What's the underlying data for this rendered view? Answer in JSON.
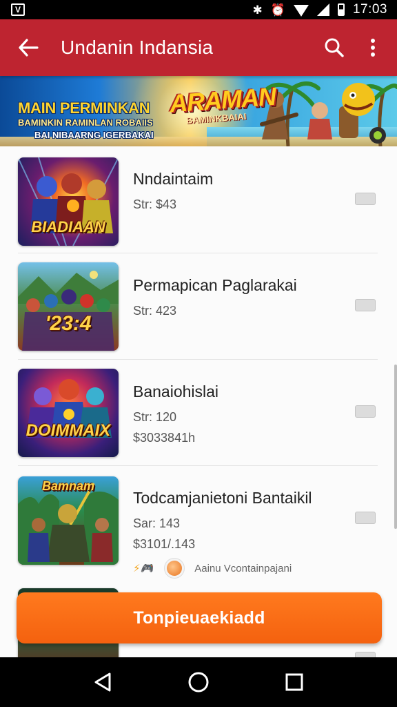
{
  "status_bar": {
    "time": "17:03",
    "icons": [
      "app-logo-icon",
      "nfc-icon",
      "alarm-icon",
      "wifi-icon",
      "signal-icon",
      "battery-icon"
    ]
  },
  "app_bar": {
    "title": "Undanin Indansia",
    "background": "#be2430",
    "icons": [
      "back-arrow-icon",
      "search-icon",
      "more-vert-icon"
    ]
  },
  "banner": {
    "headline": "MAIN PERMINKAN",
    "line2": "BAMINKIN RAMINLAN ROBAIIS",
    "line3": "BAI NIBAARNG IGERBAKAI",
    "logo": "ARAMAN",
    "logo_sub": "BAMINKBAIAI"
  },
  "items": [
    {
      "thumb_text": "BIADIAAN",
      "title": "Nndaintaim",
      "lines": [
        "Str: $43"
      ]
    },
    {
      "thumb_text": "'23:4",
      "title": "Permapican Paglarakai",
      "lines": [
        "Str: 423"
      ]
    },
    {
      "thumb_text": "DOIMMAIX",
      "title": "Banaiohislai",
      "lines": [
        "Str: 120",
        "$3033841h"
      ]
    },
    {
      "thumb_text": "Bamnam",
      "title": "Todcamjanietoni Bantaikil",
      "lines": [
        "Sar: 143",
        "$3101/.143"
      ]
    },
    {
      "thumb_text": "",
      "title": "",
      "lines": []
    }
  ],
  "source_row": {
    "logo_text": "⚡🎮",
    "label": "Aainu Vcontainpajani"
  },
  "cta": {
    "label": "Tonpieuaekiadd",
    "color": "#f4610f"
  },
  "nav_bar": {
    "icons": [
      "back-triangle-icon",
      "home-circle-icon",
      "recents-square-icon"
    ]
  }
}
